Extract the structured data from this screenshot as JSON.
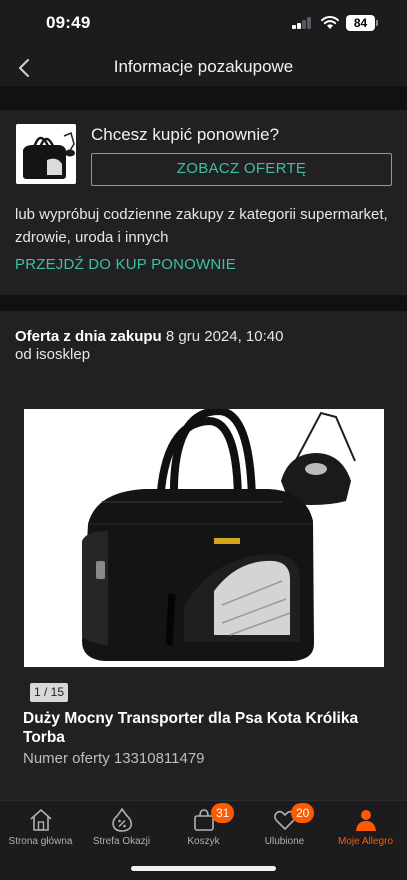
{
  "status_bar": {
    "time": "09:49",
    "battery": "84"
  },
  "header": {
    "title": "Informacje pozakupowe"
  },
  "rebuy": {
    "question": "Chcesz kupić ponownie?",
    "offer_button": "ZOBACZ OFERTĘ",
    "description": "lub wypróbuj codzienne zakupy z kategorii supermarket, zdrowie, uroda i innych",
    "link": "PRZEJDŹ DO KUP PONOWNIE"
  },
  "offer": {
    "heading_label": "Oferta z dnia zakupu",
    "date": "8 gru 2024, 10:40",
    "seller": "od isosklep",
    "image_counter": "1 / 15",
    "product_title": "Duży Mocny Transporter dla Psa Kota Królika Torba",
    "offer_number": "Numer oferty 13310811479"
  },
  "tabs": [
    {
      "label": "Strona główna",
      "icon": "home-icon"
    },
    {
      "label": "Strefa Okazji",
      "icon": "percent-tag-icon"
    },
    {
      "label": "Koszyk",
      "icon": "cart-icon",
      "badge": "31"
    },
    {
      "label": "Ulubione",
      "icon": "heart-icon",
      "badge": "20"
    },
    {
      "label": "Moje Allegro",
      "icon": "user-icon",
      "active": true
    }
  ],
  "colors": {
    "accent_teal": "#3fbfa8",
    "accent_orange": "#ff5a00",
    "background": "#1c1c1e"
  }
}
